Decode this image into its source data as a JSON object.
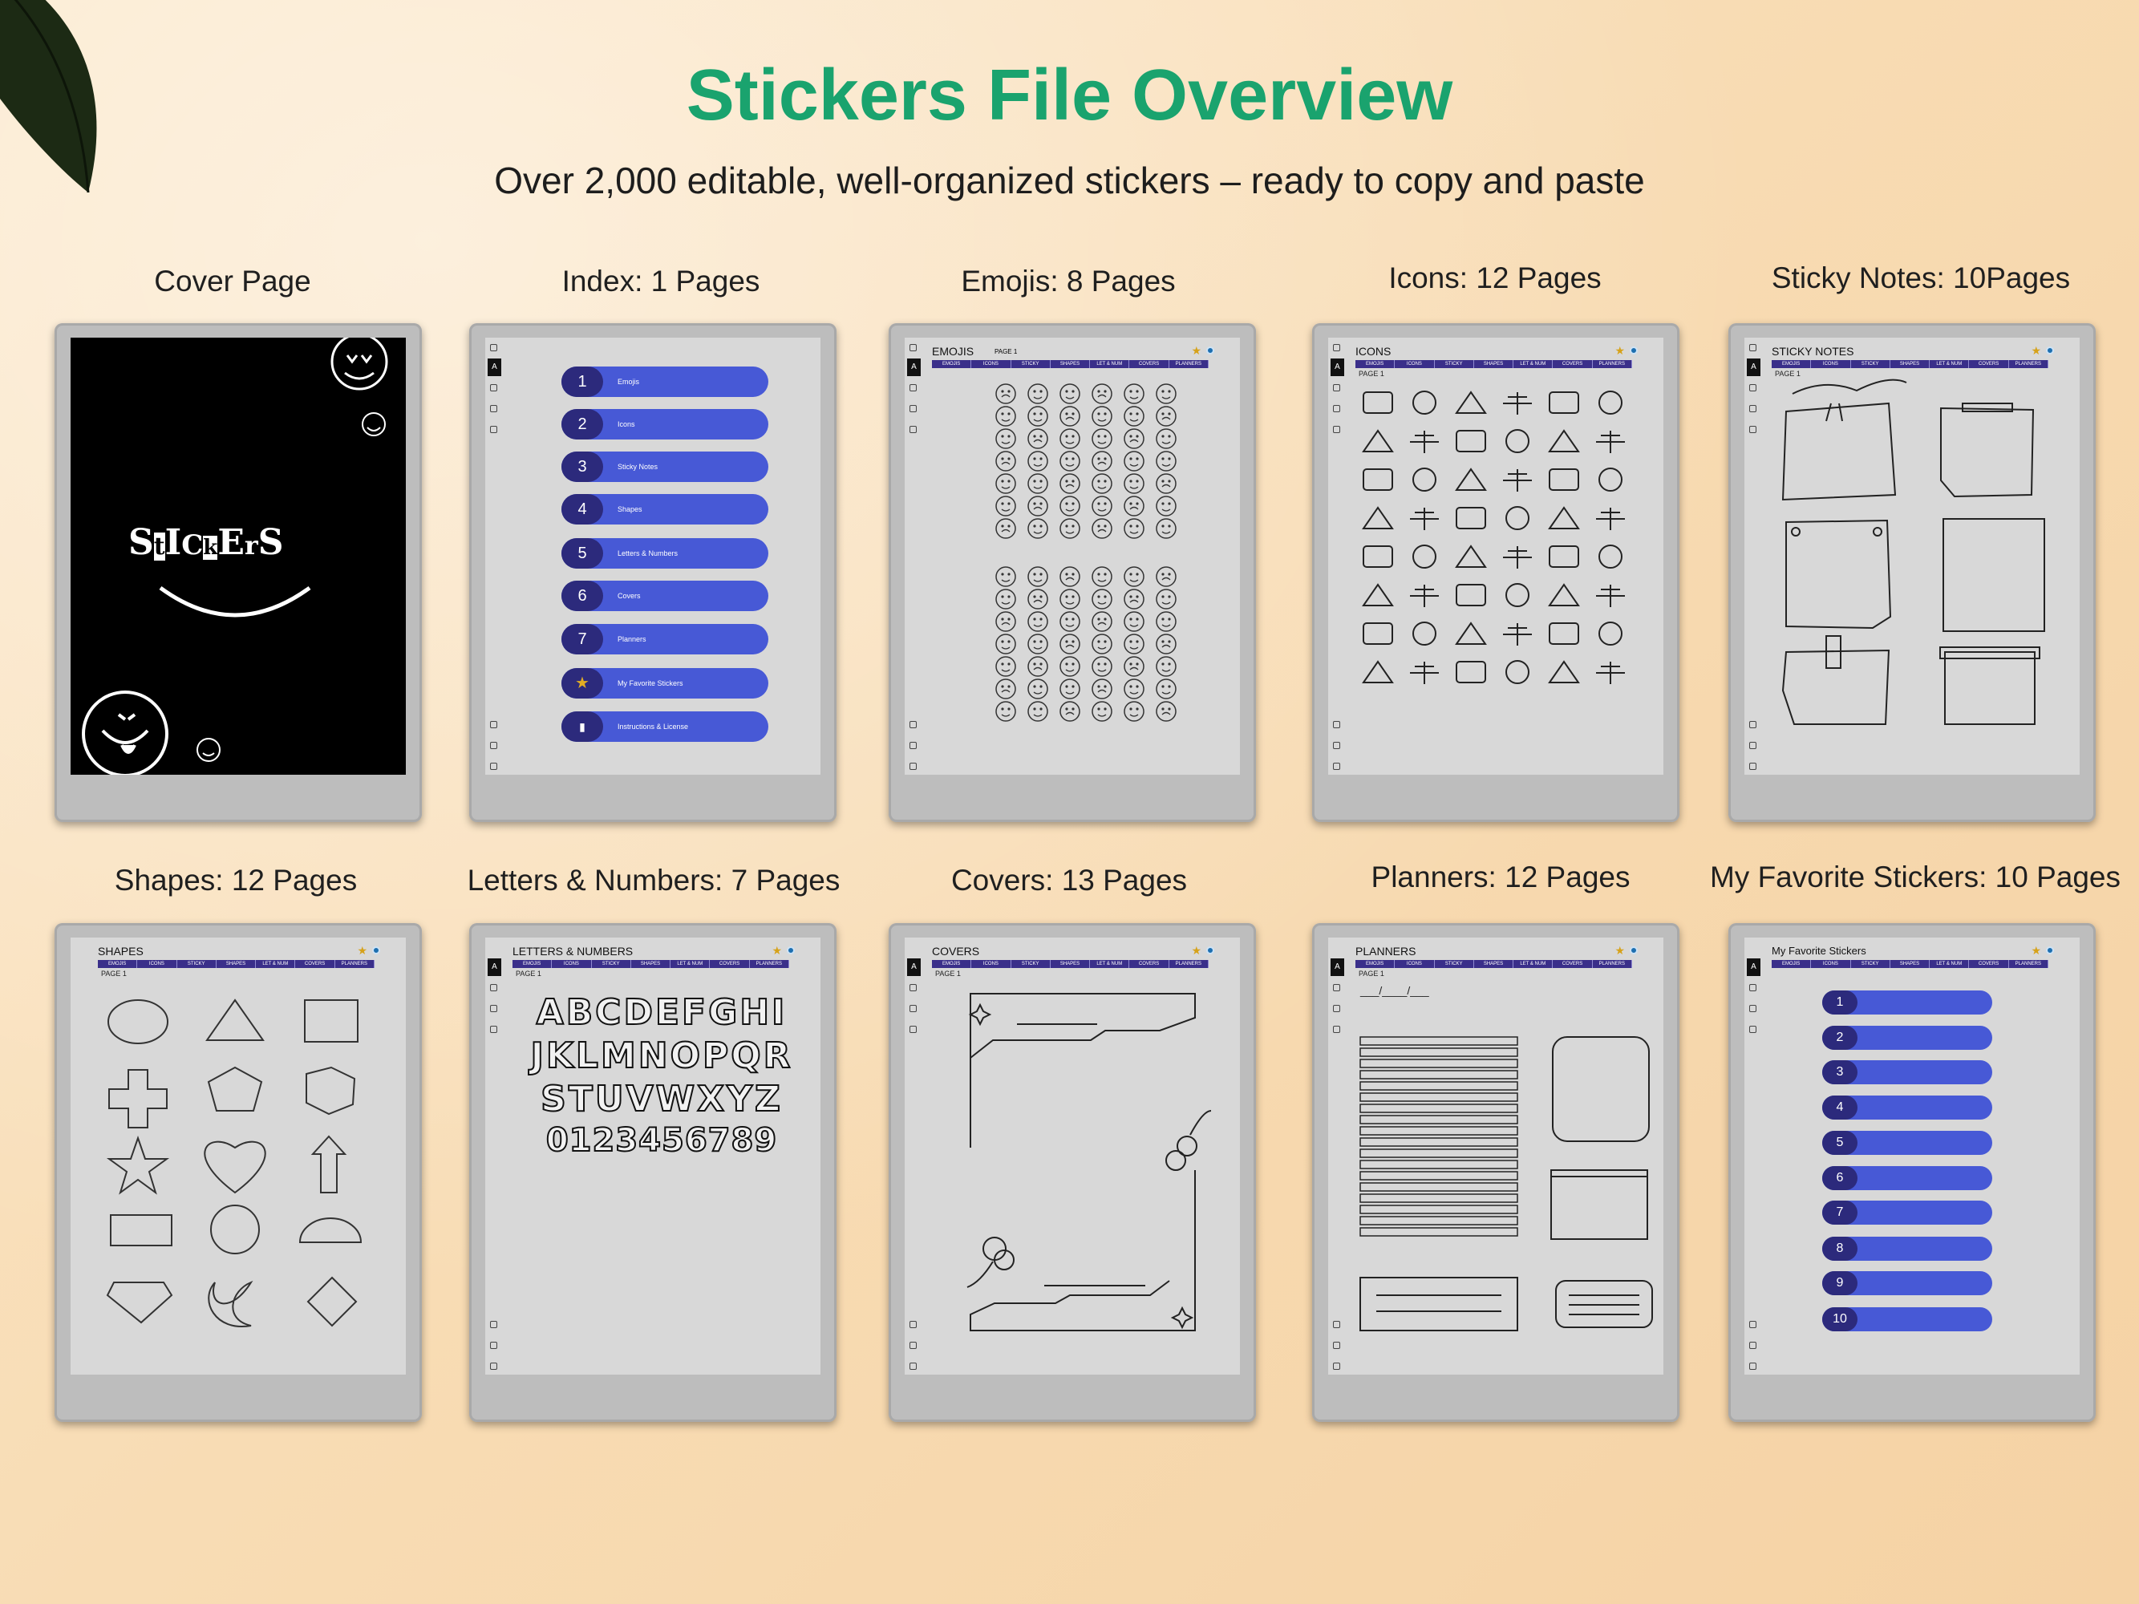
{
  "header": {
    "title": "Stickers File Overview",
    "subtitle": "Over 2,000 editable, well-organized stickers – ready to copy and paste"
  },
  "labels": {
    "cover": "Cover Page",
    "index": "Index: 1 Pages",
    "emojis": "Emojis: 8 Pages",
    "icons": "Icons: 12 Pages",
    "sticky": "Sticky Notes: 10Pages",
    "shapes": "Shapes: 12 Pages",
    "letters": "Letters & Numbers: 7 Pages",
    "covers": "Covers: 13 Pages",
    "planners": "Planners: 12 Pages",
    "favorites": "My Favorite Stickers: 10 Pages"
  },
  "tabs": [
    "EMOJIS",
    "ICONS",
    "STICKY",
    "SHAPES",
    "LET & NUM",
    "COVERS",
    "PLANNERS"
  ],
  "page_label": "PAGE 1",
  "cover": {
    "word_letters": [
      "S",
      "t",
      "I",
      "C",
      "k",
      "E",
      "r",
      "S"
    ]
  },
  "index_items": [
    {
      "num": "1",
      "label": "Emojis"
    },
    {
      "num": "2",
      "label": "Icons"
    },
    {
      "num": "3",
      "label": "Sticky Notes"
    },
    {
      "num": "4",
      "label": "Shapes"
    },
    {
      "num": "5",
      "label": "Letters & Numbers"
    },
    {
      "num": "6",
      "label": "Covers"
    },
    {
      "num": "7",
      "label": "Planners"
    },
    {
      "num": "★",
      "label": "My Favorite Stickers"
    },
    {
      "num": "▮",
      "label": "Instructions & License"
    }
  ],
  "screens": {
    "emojis": {
      "title": "EMOJIS",
      "page": "PAGE 1"
    },
    "icons": {
      "title": "ICONS"
    },
    "sticky": {
      "title": "STICKY NOTES"
    },
    "shapes": {
      "title": "SHAPES"
    },
    "letters": {
      "title": "LETTERS & NUMBERS"
    },
    "covers": {
      "title": "COVERS"
    },
    "planners": {
      "title": "PLANNERS",
      "date_line": "___/____/___"
    },
    "favorites": {
      "title": "My Favorite Stickers"
    }
  },
  "letter_rows": [
    "ABCDEFGHI",
    "JKLMNOPQR",
    "STUVWXYZ",
    "0123456789"
  ],
  "favorite_numbers": [
    "1",
    "2",
    "3",
    "4",
    "5",
    "6",
    "7",
    "8",
    "9",
    "10"
  ],
  "icons": {
    "star": "star-icon",
    "info": "info-dot-icon",
    "toolbar": [
      "home-icon",
      "menu-icon",
      "pen-icon",
      "move-icon",
      "search-icon",
      "undo-icon",
      "redo-icon",
      "export-icon",
      "settings-icon",
      "document-icon"
    ]
  },
  "colors": {
    "title": "#1aa36e",
    "tab_bar": "#3a2f8a",
    "pill": "#4759d6",
    "pill_number": "#2c2a7c",
    "star": "#d6a21a"
  }
}
